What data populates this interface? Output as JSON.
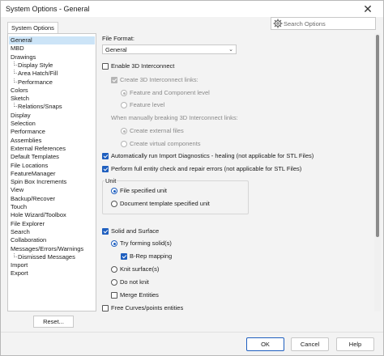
{
  "window": {
    "title": "System Options - General",
    "close_glyph": "✕"
  },
  "tab": {
    "label": "System Options"
  },
  "search": {
    "placeholder": "Search Options"
  },
  "tree": {
    "items": [
      {
        "label": "General",
        "level": 0,
        "selected": true
      },
      {
        "label": "MBD",
        "level": 0
      },
      {
        "label": "Drawings",
        "level": 0
      },
      {
        "label": "Display Style",
        "level": 1
      },
      {
        "label": "Area Hatch/Fill",
        "level": 1
      },
      {
        "label": "Performance",
        "level": 1
      },
      {
        "label": "Colors",
        "level": 0
      },
      {
        "label": "Sketch",
        "level": 0
      },
      {
        "label": "Relations/Snaps",
        "level": 1
      },
      {
        "label": "Display",
        "level": 0
      },
      {
        "label": "Selection",
        "level": 0
      },
      {
        "label": "Performance",
        "level": 0
      },
      {
        "label": "Assemblies",
        "level": 0
      },
      {
        "label": "External References",
        "level": 0
      },
      {
        "label": "Default Templates",
        "level": 0
      },
      {
        "label": "File Locations",
        "level": 0
      },
      {
        "label": "FeatureManager",
        "level": 0
      },
      {
        "label": "Spin Box Increments",
        "level": 0
      },
      {
        "label": "View",
        "level": 0
      },
      {
        "label": "Backup/Recover",
        "level": 0
      },
      {
        "label": "Touch",
        "level": 0
      },
      {
        "label": "Hole Wizard/Toolbox",
        "level": 0
      },
      {
        "label": "File Explorer",
        "level": 0
      },
      {
        "label": "Search",
        "level": 0
      },
      {
        "label": "Collaboration",
        "level": 0
      },
      {
        "label": "Messages/Errors/Warnings",
        "level": 0
      },
      {
        "label": "Dismissed Messages",
        "level": 1
      },
      {
        "label": "Import",
        "level": 0
      },
      {
        "label": "Export",
        "level": 0
      }
    ],
    "reset_label": "Reset..."
  },
  "general": {
    "file_format_label": "File Format:",
    "file_format_value": "General",
    "enable_3d_interconnect": {
      "label": "Enable 3D Interconnect",
      "checked": false
    },
    "create_links": {
      "label": "Create 3D Interconnect links:",
      "checked": true,
      "disabled": true
    },
    "feature_and_component_level": {
      "label": "Feature and Component level",
      "on": true,
      "disabled": true
    },
    "feature_level": {
      "label": "Feature level",
      "on": false,
      "disabled": true
    },
    "when_breaking_label": "When manually breaking 3D Interconnect links:",
    "create_external_files": {
      "label": "Create external files",
      "on": true,
      "disabled": true
    },
    "create_virtual_components": {
      "label": "Create virtual components",
      "on": false,
      "disabled": true
    },
    "auto_import_diagnostics": {
      "label": "Automatically run Import Diagnostics - healing (not applicable for STL Files)",
      "checked": true
    },
    "full_entity_check": {
      "label": "Perform full entity check and repair errors (not applicable for STL Files)",
      "checked": true
    },
    "unit_group": {
      "title": "Unit",
      "file_specified_unit": {
        "label": "File specified unit",
        "on": true
      },
      "document_template_unit": {
        "label": "Document template specified unit",
        "on": false
      }
    },
    "solid_and_surface": {
      "label": "Solid and Surface",
      "checked": true
    },
    "try_forming_solids": {
      "label": "Try forming solid(s)",
      "on": true
    },
    "brep_mapping": {
      "label": "B-Rep mapping",
      "checked": true
    },
    "knit_surfaces": {
      "label": "Knit surface(s)",
      "on": false
    },
    "do_not_knit": {
      "label": "Do not knit",
      "on": false
    },
    "merge_entities": {
      "label": "Merge Entities",
      "checked": false
    },
    "free_curves_points": {
      "label": "Free Curves/points entities",
      "checked": false
    }
  },
  "footer": {
    "ok_label": "OK",
    "cancel_label": "Cancel",
    "help_label": "Help"
  },
  "colors": {
    "accent": "#1f5fbf",
    "selection": "#cce4f7",
    "dialog_bg": "#f3f3f3"
  }
}
